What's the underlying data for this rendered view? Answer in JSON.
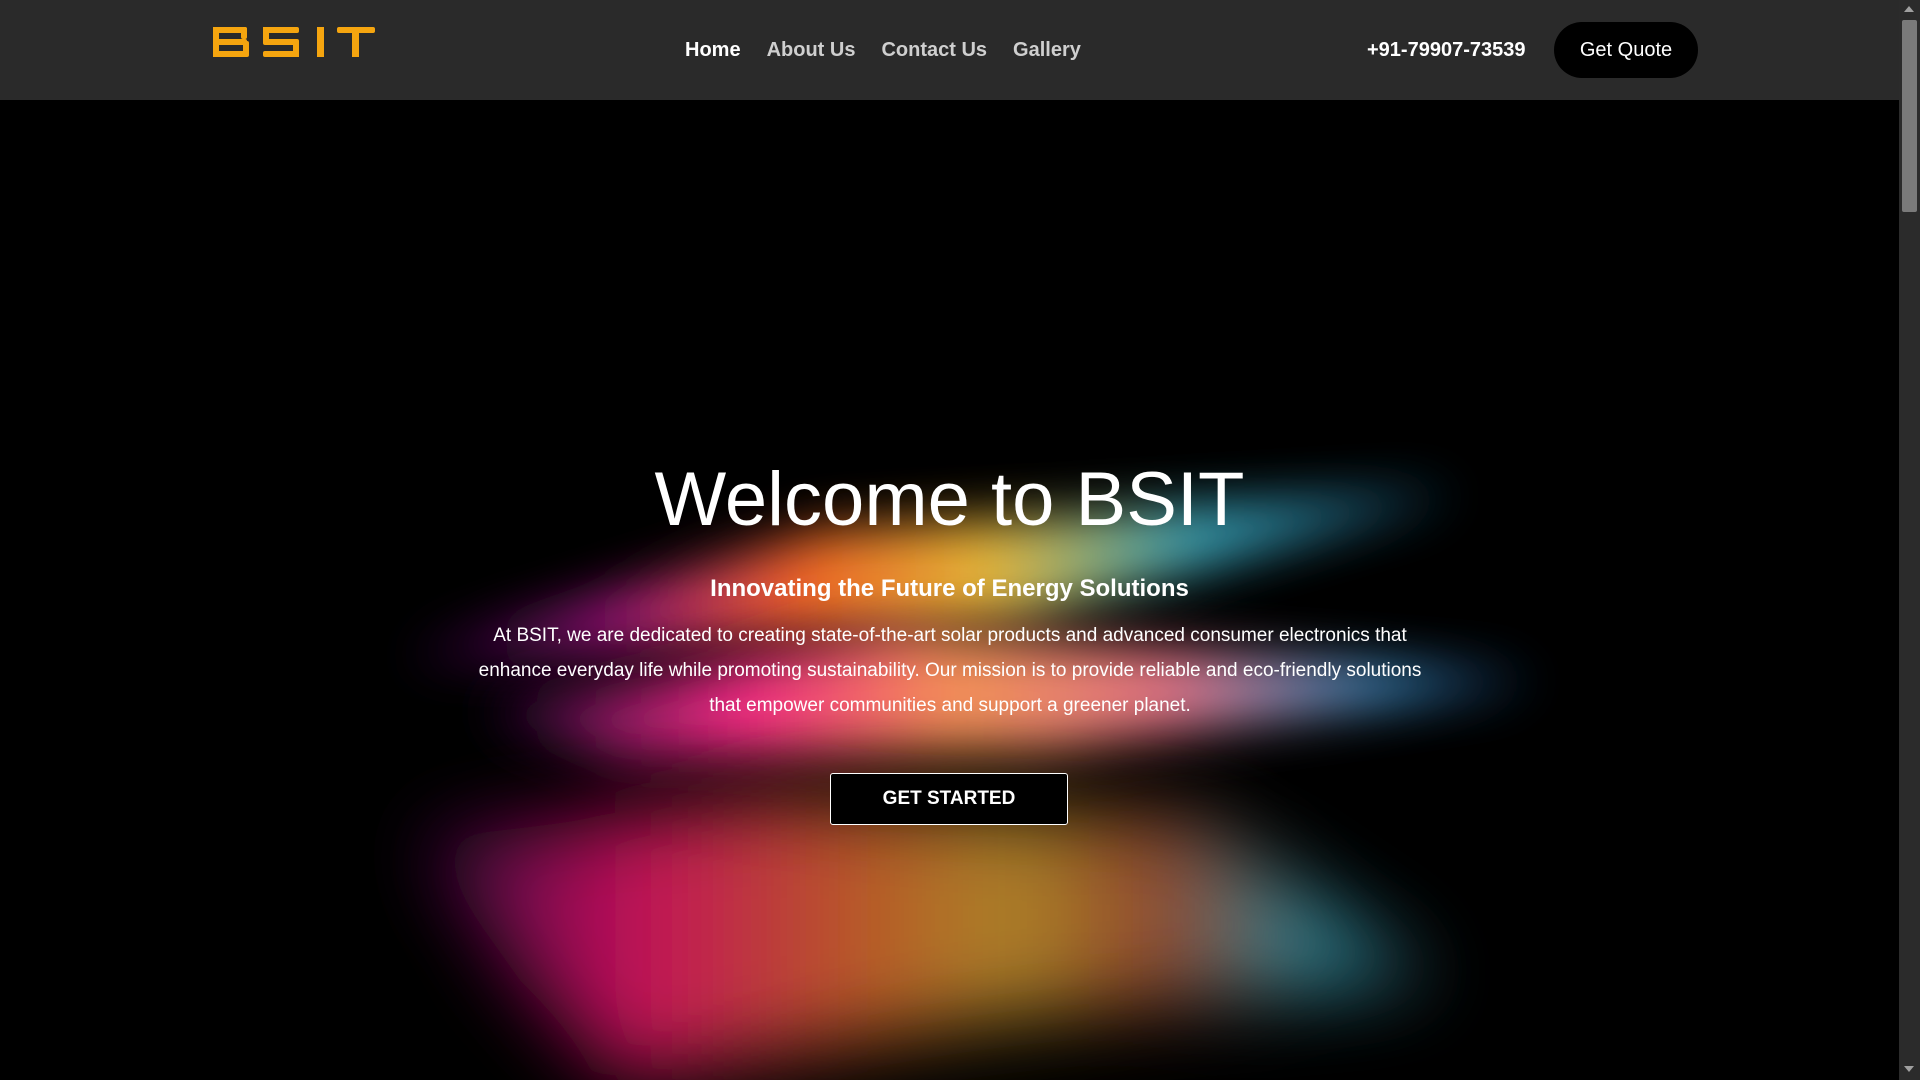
{
  "header": {
    "logo_text": "BSIT",
    "logo_color": "#f5a50f",
    "nav": [
      {
        "label": "Home",
        "active": true
      },
      {
        "label": "About Us",
        "active": false
      },
      {
        "label": "Contact Us",
        "active": false
      },
      {
        "label": "Gallery",
        "active": false
      }
    ],
    "phone": "+91-79907-73539",
    "quote_label": "Get Quote"
  },
  "hero": {
    "title": "Welcome to BSIT",
    "subtitle": "Innovating the Future of Energy Solutions",
    "description": "At BSIT, we are dedicated to creating state-of-the-art solar products and advanced consumer electronics that enhance everyday life while promoting sustainability. Our mission is to provide reliable and eco-friendly solutions that empower communities and support a greener planet.",
    "cta_label": "GET STARTED"
  },
  "colors": {
    "header_bg": "#2a2a2a",
    "hero_bg": "#000000",
    "accent": "#f5a50f"
  }
}
